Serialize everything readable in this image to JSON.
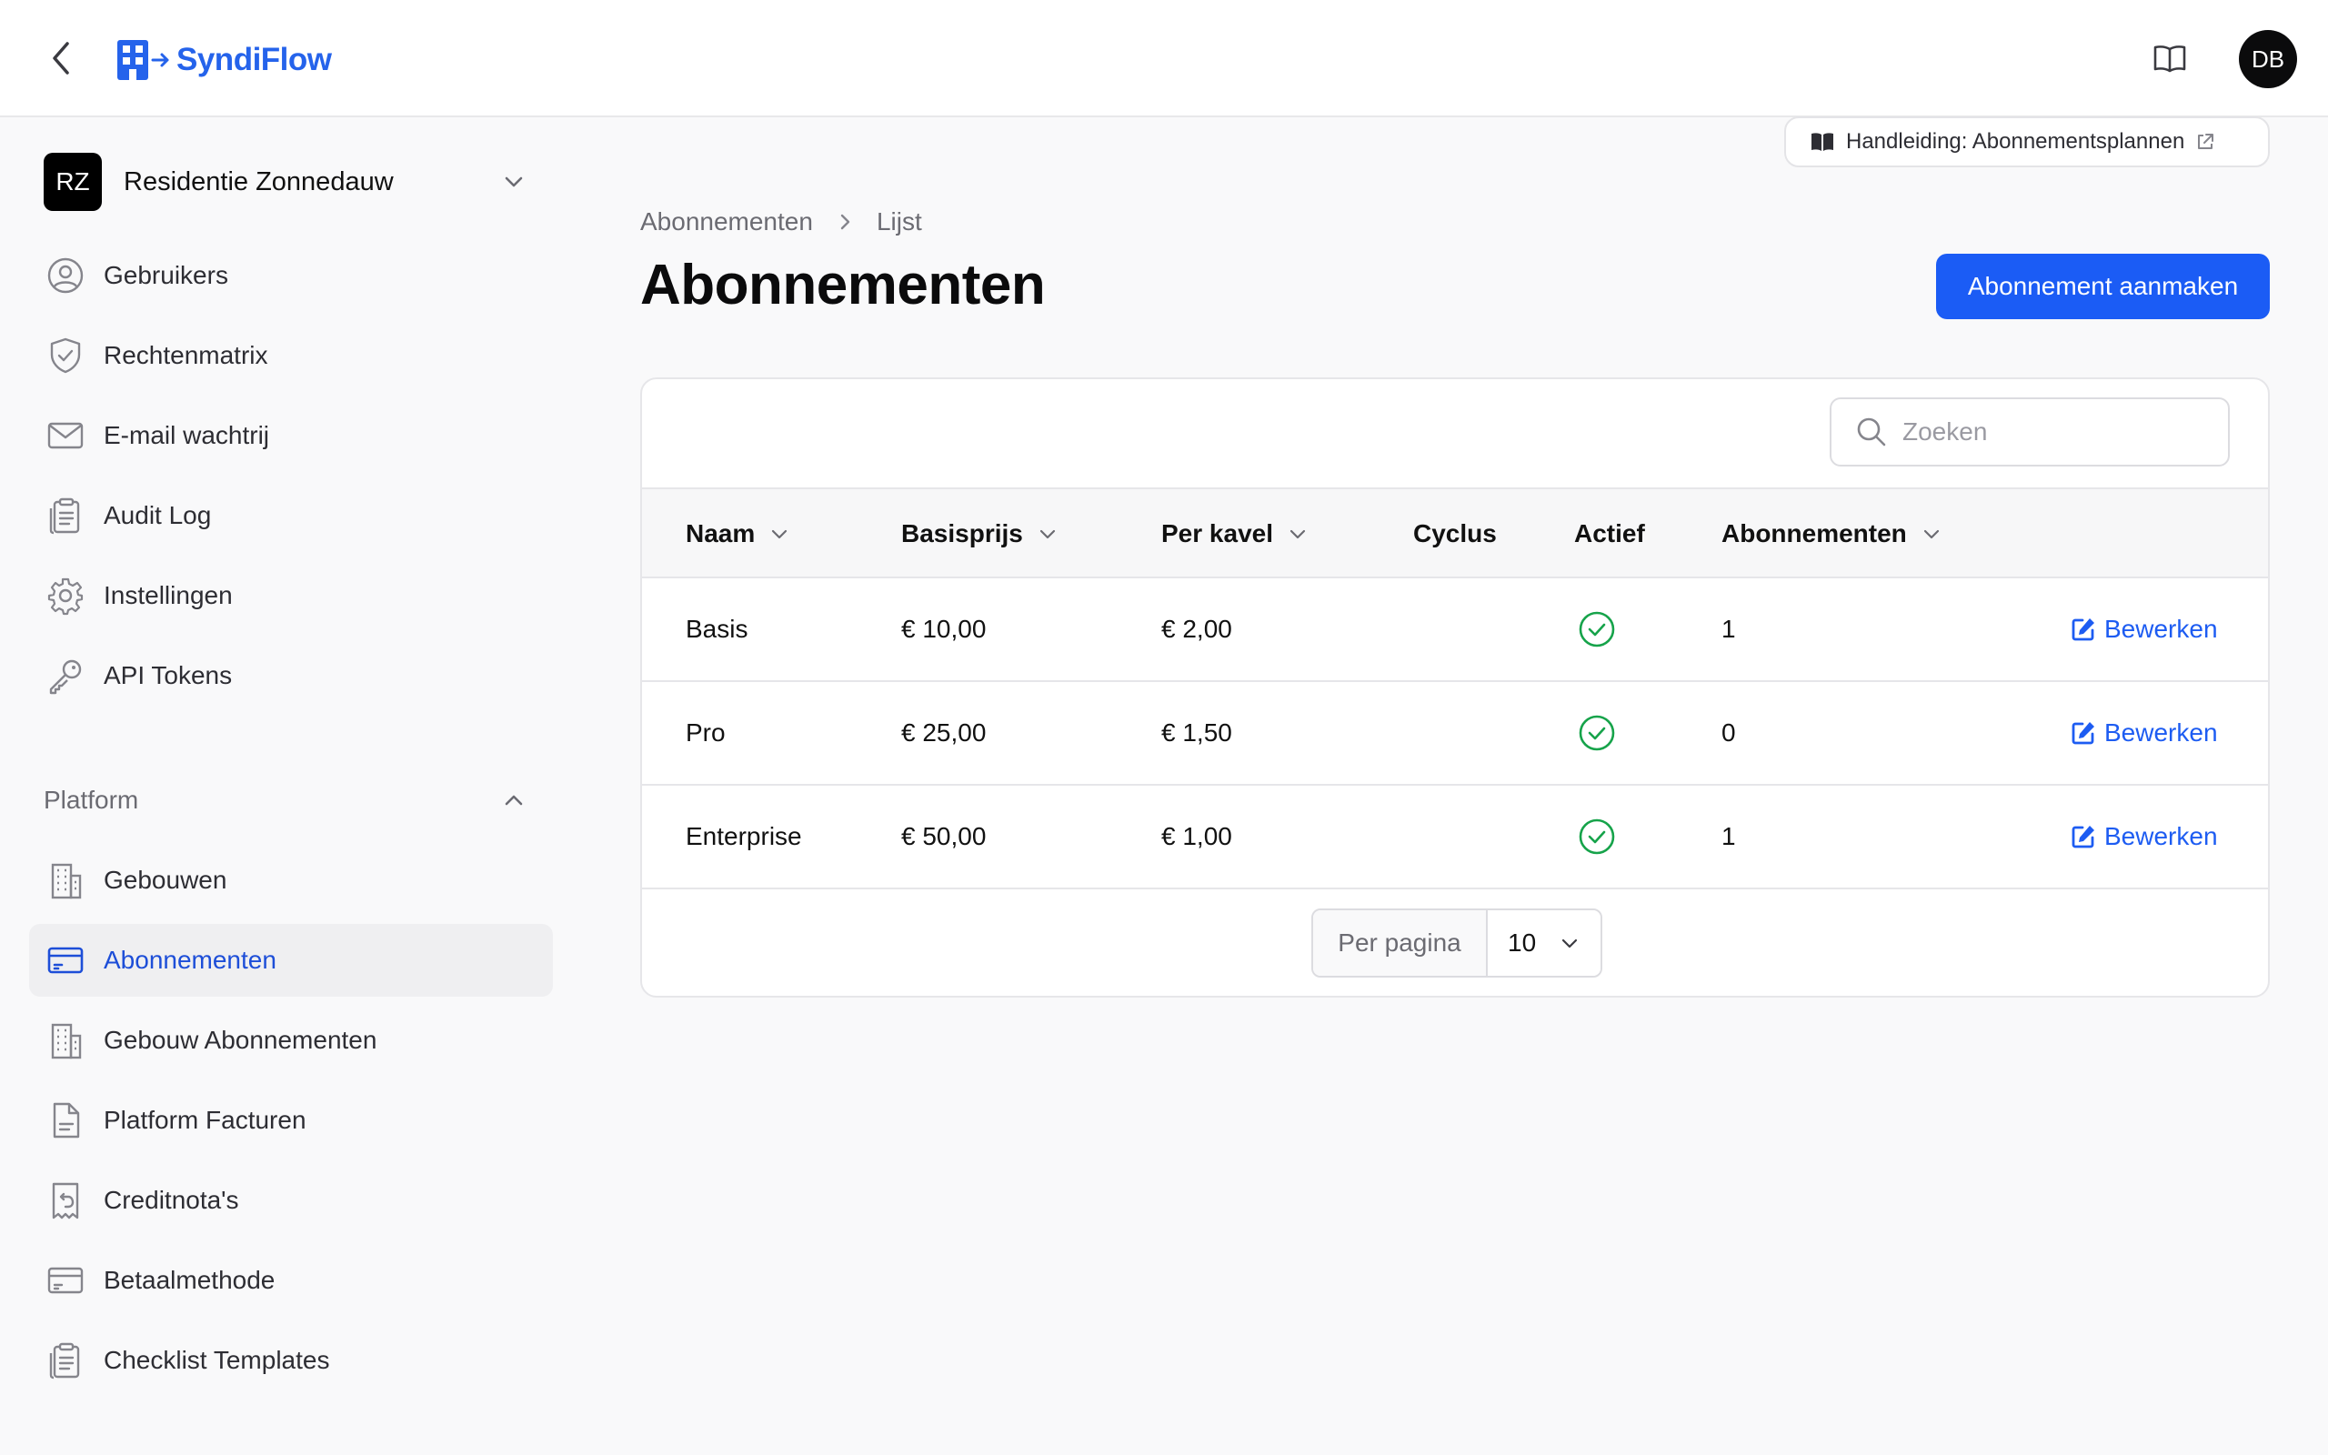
{
  "header": {
    "brand": "SyndiFlow",
    "avatar_initials": "DB"
  },
  "org": {
    "initials": "RZ",
    "name": "Residentie Zonnedauw"
  },
  "nav": [
    {
      "label": "Gebruikers",
      "icon": "user-circle-icon"
    },
    {
      "label": "Rechtenmatrix",
      "icon": "shield-check-icon"
    },
    {
      "label": "E-mail wachtrij",
      "icon": "envelope-icon"
    },
    {
      "label": "Audit Log",
      "icon": "clipboard-icon"
    },
    {
      "label": "Instellingen",
      "icon": "gear-icon"
    },
    {
      "label": "API Tokens",
      "icon": "key-icon"
    }
  ],
  "platform": {
    "heading": "Platform",
    "items": [
      {
        "label": "Gebouwen",
        "icon": "building-icon"
      },
      {
        "label": "Abonnementen",
        "icon": "credit-card-icon",
        "active": true
      },
      {
        "label": "Gebouw Abonnementen",
        "icon": "building-icon"
      },
      {
        "label": "Platform Facturen",
        "icon": "document-icon"
      },
      {
        "label": "Creditnota's",
        "icon": "receipt-refund-icon"
      },
      {
        "label": "Betaalmethode",
        "icon": "credit-card-icon"
      },
      {
        "label": "Checklist Templates",
        "icon": "clipboard-icon"
      }
    ]
  },
  "guide": {
    "label": "Handleiding: Abonnementsplannen"
  },
  "breadcrumb": [
    "Abonnementen",
    "Lijst"
  ],
  "page": {
    "title": "Abonnementen",
    "create_label": "Abonnement aanmaken"
  },
  "search": {
    "placeholder": "Zoeken"
  },
  "table": {
    "columns": [
      "Naam",
      "Basisprijs",
      "Per kavel",
      "Cyclus",
      "Actief",
      "Abonnementen"
    ],
    "edit_label": "Bewerken",
    "rows": [
      {
        "name": "Basis",
        "base": "€ 10,00",
        "per_lot": "€ 2,00",
        "cycle": "",
        "active": true,
        "subs": "1"
      },
      {
        "name": "Pro",
        "base": "€ 25,00",
        "per_lot": "€ 1,50",
        "cycle": "",
        "active": true,
        "subs": "0"
      },
      {
        "name": "Enterprise",
        "base": "€ 50,00",
        "per_lot": "€ 1,00",
        "cycle": "",
        "active": true,
        "subs": "1"
      }
    ]
  },
  "pagination": {
    "per_page_label": "Per pagina",
    "per_page_value": "10"
  },
  "colors": {
    "accent": "#1b5cf5",
    "link": "#1d5cf2",
    "success": "#16a34a"
  }
}
